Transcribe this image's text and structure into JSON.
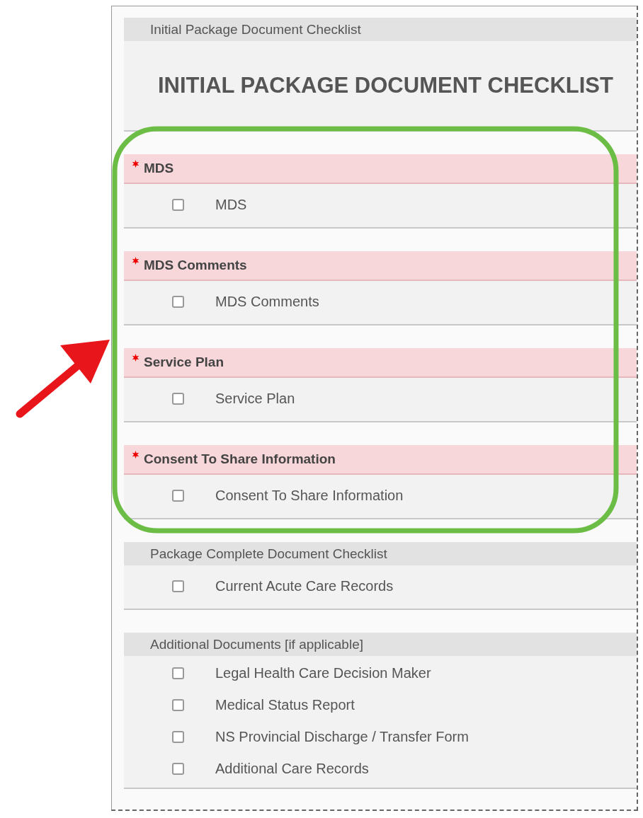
{
  "sections": [
    {
      "kind": "banner",
      "title": "Initial Package Document Checklist",
      "heading": "INITIAL PACKAGE DOCUMENT CHECKLIST"
    },
    {
      "kind": "checklist",
      "required": true,
      "title": "MDS",
      "items": [
        {
          "label": "MDS",
          "checked": false
        }
      ]
    },
    {
      "kind": "checklist",
      "required": true,
      "title": "MDS Comments",
      "items": [
        {
          "label": "MDS Comments",
          "checked": false
        }
      ]
    },
    {
      "kind": "checklist",
      "required": true,
      "title": "Service Plan",
      "items": [
        {
          "label": "Service Plan",
          "checked": false
        }
      ]
    },
    {
      "kind": "checklist",
      "required": true,
      "title": "Consent To Share Information",
      "items": [
        {
          "label": "Consent To Share Information",
          "checked": false
        }
      ]
    },
    {
      "kind": "checklist",
      "required": false,
      "title": "Package Complete Document Checklist",
      "items": [
        {
          "label": "Current Acute Care Records",
          "checked": false
        }
      ]
    },
    {
      "kind": "checklist",
      "required": false,
      "title": "Additional Documents [if applicable]",
      "items": [
        {
          "label": "Legal Health Care Decision Maker",
          "checked": false
        },
        {
          "label": "Medical Status Report",
          "checked": false
        },
        {
          "label": "NS Provincial Discharge / Transfer Form",
          "checked": false
        },
        {
          "label": "Additional Care Records",
          "checked": false
        }
      ]
    }
  ]
}
